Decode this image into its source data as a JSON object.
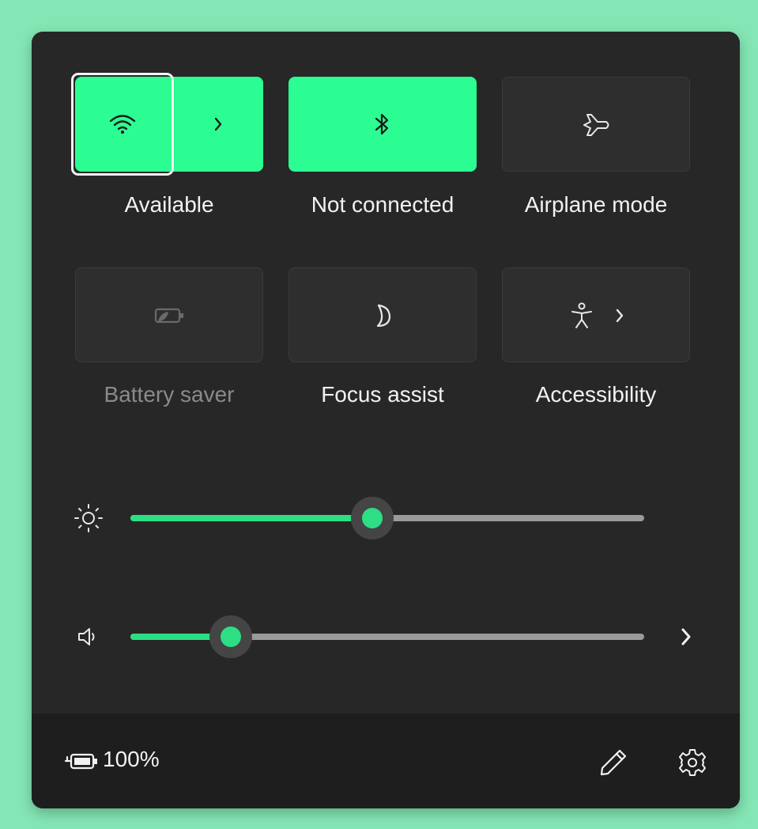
{
  "quick_settings": {
    "tiles": {
      "wifi": {
        "label": "Available",
        "state": "on"
      },
      "bluetooth": {
        "label": "Not connected",
        "state": "on"
      },
      "airplane": {
        "label": "Airplane mode",
        "state": "off"
      },
      "battery_saver": {
        "label": "Battery saver",
        "state": "disabled"
      },
      "focus_assist": {
        "label": "Focus assist",
        "state": "off"
      },
      "accessibility": {
        "label": "Accessibility",
        "state": "off"
      }
    },
    "sliders": {
      "brightness": {
        "value_fraction": 0.47
      },
      "volume": {
        "value_fraction": 0.195
      }
    },
    "footer": {
      "battery_percent": "100%"
    }
  },
  "colors": {
    "accent": "#2cfd92",
    "slider_accent": "#2cdf84",
    "panel_bg": "#272727",
    "footer_bg": "#1e1e1e",
    "page_bg": "#84e6b4"
  },
  "icons": {
    "wifi": "wifi-icon",
    "wifi_expand": "chevron-right-icon",
    "bluetooth": "bluetooth-icon",
    "airplane": "airplane-icon",
    "battery_saver": "battery-saver-icon",
    "focus_assist": "moon-icon",
    "accessibility": "accessibility-icon",
    "accessibility_expand": "chevron-right-icon",
    "brightness": "sun-icon",
    "volume": "speaker-icon",
    "volume_output": "chevron-right-icon",
    "battery": "battery-charging-icon",
    "edit": "pencil-icon",
    "settings": "gear-icon"
  }
}
